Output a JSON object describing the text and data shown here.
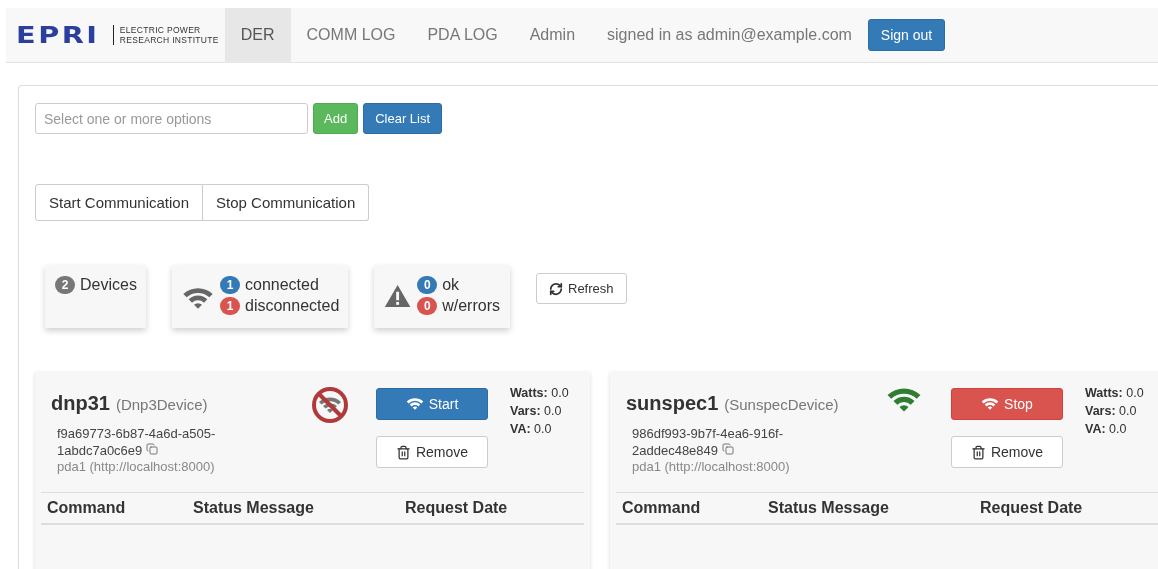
{
  "logo": {
    "mark": "EPRI",
    "name_lines": [
      "ELECTRIC POWER",
      "RESEARCH INSTITUTE"
    ]
  },
  "nav": [
    {
      "label": "DER",
      "selected": true
    },
    {
      "label": "COMM LOG",
      "selected": false
    },
    {
      "label": "PDA LOG",
      "selected": false
    },
    {
      "label": "Admin",
      "selected": false
    }
  ],
  "signed_in": "signed in as admin@example.com",
  "sign_out": "Sign out",
  "select": {
    "placeholder": "Select one or more options"
  },
  "add": "Add",
  "clear": "Clear List",
  "comm_buttons": [
    "Start Communication",
    "Stop Communication"
  ],
  "stats": {
    "devices": {
      "count": "2",
      "label": "Devices"
    },
    "connected": {
      "count": "1",
      "label": "connected"
    },
    "disconnected": {
      "count": "1",
      "label": "disconnected"
    },
    "ok": {
      "count": "0",
      "label": "ok"
    },
    "errors": {
      "count": "0",
      "label": "w/errors"
    }
  },
  "refresh": "Refresh",
  "devices": [
    {
      "name": "dnp31",
      "type": "(Dnp3Device)",
      "id_lines": [
        "f9a69773-6b87-4a6d-a505-",
        "1abdc7a0c6e9"
      ],
      "pda": "pda1 (http://localhost:8000)",
      "connected": false,
      "action": "Start",
      "remove": "Remove",
      "metrics": [
        {
          "label": "Watts:",
          "value": "0.0"
        },
        {
          "label": "Vars:",
          "value": "0.0"
        },
        {
          "label": "VA:",
          "value": "0.0"
        }
      ],
      "columns": [
        "Command",
        "Status Message",
        "Request Date"
      ]
    },
    {
      "name": "sunspec1",
      "type": "(SunspecDevice)",
      "id_lines": [
        "986df993-9b7f-4ea6-916f-",
        "2addec48e849"
      ],
      "pda": "pda1 (http://localhost:8000)",
      "connected": true,
      "action": "Stop",
      "remove": "Remove",
      "metrics": [
        {
          "label": "Watts:",
          "value": "0.0"
        },
        {
          "label": "Vars:",
          "value": "0.0"
        },
        {
          "label": "VA:",
          "value": "0.0"
        }
      ],
      "columns": [
        "Command",
        "Status Message",
        "Request Date"
      ]
    }
  ]
}
